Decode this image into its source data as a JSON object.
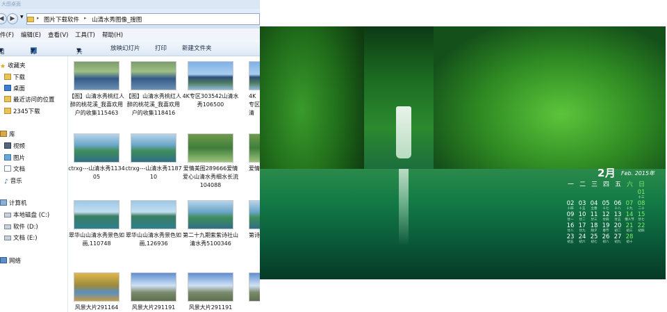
{
  "explorer": {
    "title": "大图桌面",
    "breadcrumb": [
      "图片下载软件",
      "山清水秀图像_搜图"
    ],
    "menu": [
      "件(F)",
      "编辑(E)",
      "查看(V)",
      "工具(T)",
      "帮助(H)"
    ],
    "toolbar": {
      "organize": "组织",
      "open": "打开",
      "share": "共享",
      "slideshow": "放映幻灯片",
      "print": "打印",
      "new_folder": "新建文件夹"
    },
    "nav": {
      "favorites": "收藏夹",
      "fav_items": [
        "下载",
        "桌面",
        "最近访问的位置",
        "2345下载"
      ],
      "library": "库",
      "lib_items": [
        "视频",
        "图片",
        "文档",
        "音乐"
      ],
      "computer": "计算机",
      "drives": [
        "本地磁盘 (C:)",
        "软件 (D:)",
        "文档 (E:)"
      ],
      "network": "网络"
    },
    "files": [
      {
        "name": "【图】山清水秀桃红人醉的桃花溪_我喜欢用户的收集115463"
      },
      {
        "name": "【图】山清水秀桃红人醉的桃花溪_我喜欢用户的收集118416"
      },
      {
        "name": "4K专区303542山清水秀106500"
      },
      {
        "name": "4K专区清"
      },
      {
        "name": "ctrxg---山清水秀113405"
      },
      {
        "name": "ctrxg---山清水秀118710"
      },
      {
        "name": "爱情美图289666爱情爱心山清水秀细水长流104088"
      },
      {
        "name": "爱情"
      },
      {
        "name": "翠华山山清水秀景色如画,110748"
      },
      {
        "name": "翠华山山清水秀景色如画,126936"
      },
      {
        "name": "第二十九期紫紫诗社山清水秀5100346"
      },
      {
        "name": "第诗"
      },
      {
        "name": "风景大片291164"
      },
      {
        "name": "风景大片291191"
      },
      {
        "name": "风景大片291191"
      },
      {
        "name": ""
      }
    ]
  },
  "calendar": {
    "month": "2月",
    "year": "Feb. 2015年",
    "weekdays": [
      "一",
      "二",
      "三",
      "四",
      "五",
      "六",
      "日"
    ],
    "days": [
      {
        "d": "01",
        "l": "十三",
        "weekend": true
      },
      {
        "d": "02",
        "l": "十四"
      },
      {
        "d": "03",
        "l": "十五"
      },
      {
        "d": "04",
        "l": "立春"
      },
      {
        "d": "05",
        "l": "十七"
      },
      {
        "d": "06",
        "l": "十八"
      },
      {
        "d": "07",
        "l": "十九",
        "weekend": true
      },
      {
        "d": "08",
        "l": "二十",
        "weekend": true
      },
      {
        "d": "09",
        "l": "廿一"
      },
      {
        "d": "10",
        "l": "廿二"
      },
      {
        "d": "11",
        "l": "廿三"
      },
      {
        "d": "12",
        "l": "廿四"
      },
      {
        "d": "13",
        "l": "廿五"
      },
      {
        "d": "14",
        "l": "情人节",
        "weekend": true
      },
      {
        "d": "15",
        "l": "廿七",
        "weekend": true
      },
      {
        "d": "16",
        "l": "廿八"
      },
      {
        "d": "17",
        "l": "廿九"
      },
      {
        "d": "18",
        "l": "除夕"
      },
      {
        "d": "19",
        "l": "春节"
      },
      {
        "d": "20",
        "l": "初二"
      },
      {
        "d": "21",
        "l": "初三",
        "weekend": true
      },
      {
        "d": "22",
        "l": "初四",
        "weekend": true
      },
      {
        "d": "23",
        "l": "初五"
      },
      {
        "d": "24",
        "l": "初六"
      },
      {
        "d": "25",
        "l": "初七"
      },
      {
        "d": "26",
        "l": "初八"
      },
      {
        "d": "27",
        "l": "初九"
      },
      {
        "d": "28",
        "l": "初十",
        "weekend": true
      }
    ]
  }
}
